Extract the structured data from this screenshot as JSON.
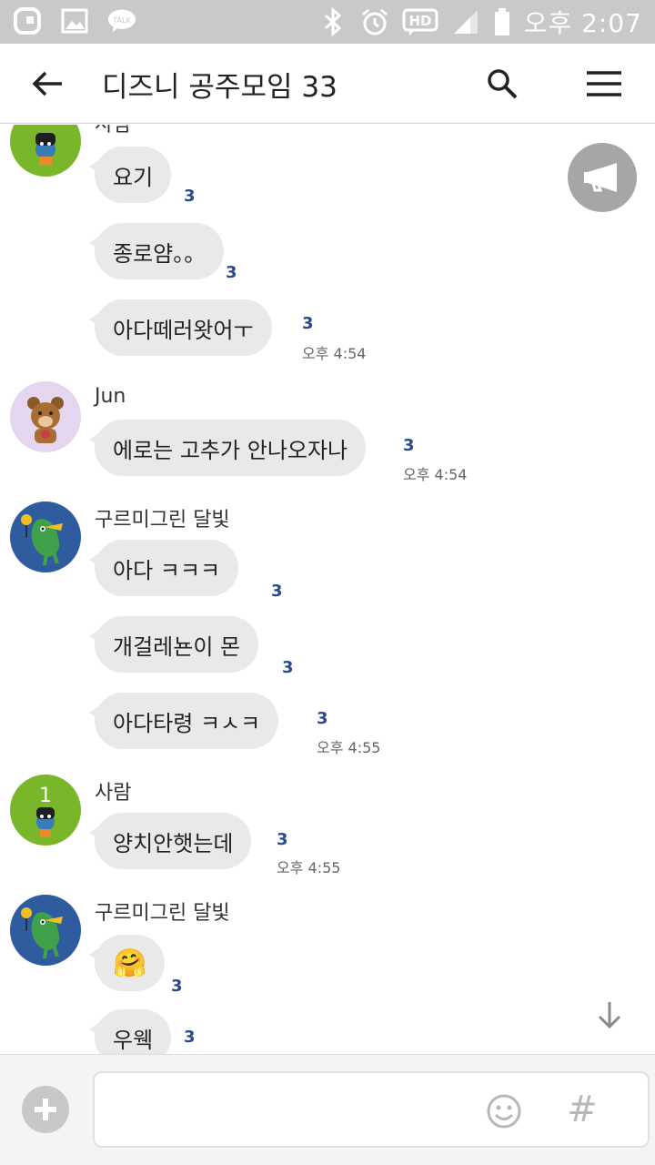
{
  "status_bar": {
    "time": "오후 2:07",
    "icons": [
      "olleh-icon",
      "gallery-icon",
      "talk-icon",
      "bluetooth-icon",
      "alarm-icon",
      "hd-voice-icon",
      "signal-icon",
      "battery-icon"
    ],
    "hd_label": "HD",
    "talk_label": "TALK"
  },
  "header": {
    "title": "디즈니 공주모임 33",
    "icons": [
      "back-arrow-icon",
      "search-icon",
      "menu-icon"
    ]
  },
  "chat": {
    "messages": [
      {
        "sender": "사람",
        "text": "요기",
        "unread": "3",
        "time": ""
      },
      {
        "sender": "사람",
        "text": "종로얌。。",
        "unread": "3",
        "time": ""
      },
      {
        "sender": "사람",
        "text": "아다떼러왓어ㅜ",
        "unread": "3",
        "time": "오후 4:54"
      },
      {
        "sender": "Jun",
        "text": "에로는 고추가 안나오자나",
        "unread": "3",
        "time": "오후 4:54"
      },
      {
        "sender": "구르미그린 달빛",
        "text": "아다 ㅋㅋㅋ",
        "unread": "3",
        "time": ""
      },
      {
        "sender": "구르미그린 달빛",
        "text": "개걸레뇬이 몬",
        "unread": "3",
        "time": ""
      },
      {
        "sender": "구르미그린 달빛",
        "text": "아다타령 ㅋㅅㅋ",
        "unread": "3",
        "time": "오후 4:55"
      },
      {
        "sender": "사람",
        "text": "양치안햇는데",
        "unread": "3",
        "time": "오후 4:55"
      },
      {
        "sender": "구르미그린 달빛",
        "text": "🤗",
        "unread": "3",
        "time": ""
      },
      {
        "sender": "구르미그린 달빛",
        "text": "우웩",
        "unread": "3",
        "time": ""
      }
    ],
    "senders": {
      "group1": "사람",
      "jun": "Jun",
      "moon1": "구르미그린 달빛",
      "saram": "사람",
      "moon2": "구르미그린 달빛"
    },
    "avatar_badge": "1"
  },
  "input_bar": {
    "placeholder": "",
    "hash_label": "#",
    "icons": [
      "plus-icon",
      "emoji-icon",
      "hashtag-icon"
    ]
  },
  "colors": {
    "status_bar": "#c9c9c9",
    "bubble": "#e9e9e9",
    "unread": "#2a4a8a",
    "avatar_green": "#7ab62a",
    "avatar_purple": "#e4d6ef",
    "avatar_blue": "#2f5c9e"
  }
}
